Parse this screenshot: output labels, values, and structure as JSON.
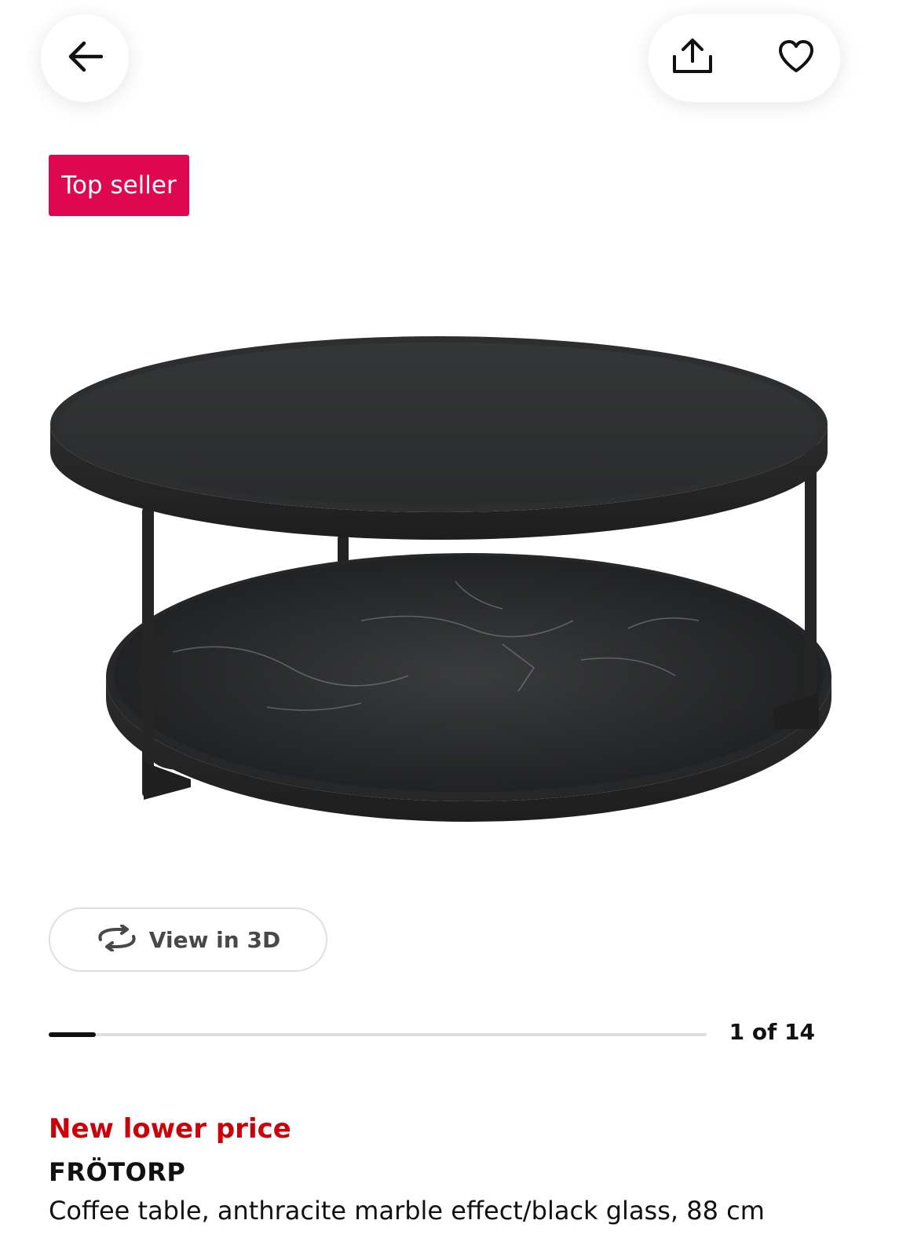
{
  "header": {
    "back_icon": "arrow-left-icon",
    "share_icon": "share-upload-icon",
    "favorite_icon": "heart-outline-icon"
  },
  "badge": {
    "label": "Top seller",
    "color": "#e00751"
  },
  "gallery": {
    "view_3d_label": "View in 3D",
    "view_3d_icon": "rotate-3d-icon",
    "current_image": 1,
    "total_images": 14,
    "counter_text": "1 of 14",
    "progress_fraction": 0.0714
  },
  "product": {
    "price_note": "New lower price",
    "price_note_color": "#cc0008",
    "name": "FRÖTORP",
    "description": "Coffee table, anthracite marble effect/black glass, 88 cm"
  }
}
